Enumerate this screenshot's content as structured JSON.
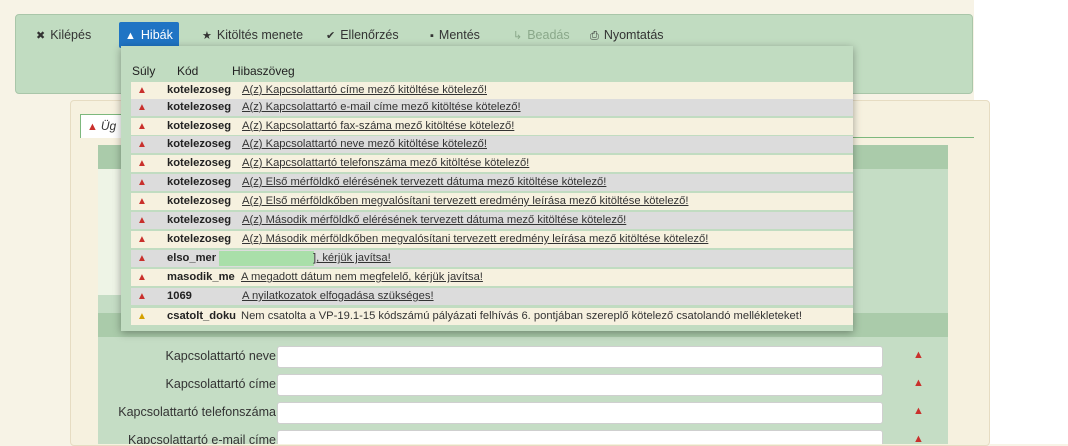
{
  "toolbar": {
    "buttons": [
      {
        "icon": "✖",
        "label": "Kilépés"
      },
      {
        "icon": "▲",
        "label": "Hibák"
      },
      {
        "icon": "★",
        "label": "Kitöltés menete"
      },
      {
        "icon": "✔",
        "label": "Ellenőrzés"
      },
      {
        "icon": "▪",
        "label": "Mentés"
      },
      {
        "icon": "↳",
        "label": "Beadás"
      },
      {
        "icon": "⎙",
        "label": "Nyomtatás"
      }
    ]
  },
  "errors_panel": {
    "headers": {
      "severity": "Súly",
      "code": "Kód",
      "message": "Hibaszöveg"
    },
    "rows": [
      {
        "severity": "error",
        "code": "kotelezoseg",
        "message": "A(z) Kapcsolattartó címe mező kitöltése kötelező!"
      },
      {
        "severity": "error",
        "code": "kotelezoseg",
        "message": "A(z) Kapcsolattartó e-mail címe mező kitöltése kötelező!"
      },
      {
        "severity": "error",
        "code": "kotelezoseg",
        "message": "A(z) Kapcsolattartó fax-száma mező kitöltése kötelező!"
      },
      {
        "severity": "error",
        "code": "kotelezoseg",
        "message": "A(z) Kapcsolattartó neve mező kitöltése kötelező!"
      },
      {
        "severity": "error",
        "code": "kotelezoseg",
        "message": "A(z) Kapcsolattartó telefonszáma mező kitöltése kötelező!"
      },
      {
        "severity": "error",
        "code": "kotelezoseg",
        "message": "A(z) Első mérföldkő elérésének tervezett dátuma mező kitöltése kötelező!"
      },
      {
        "severity": "error",
        "code": "kotelezoseg",
        "message": "A(z) Első mérföldkőben megvalósítani tervezett eredmény leírása mező kitöltése kötelező!"
      },
      {
        "severity": "error",
        "code": "kotelezoseg",
        "message": "A(z) Második mérföldkő elérésének tervezett dátuma mező kitöltése kötelező!"
      },
      {
        "severity": "error",
        "code": "kotelezoseg",
        "message": "A(z) Második mérföldkőben megvalósítani tervezett eredmény leírása mező kitöltése kötelező!"
      },
      {
        "severity": "error",
        "code": "elso_mer",
        "message": "",
        "message_tail": "], kérjük javítsa!"
      },
      {
        "severity": "error",
        "code": "masodik_me",
        "message": "A megadott dátum nem megfelelő, kérjük javítsa!"
      },
      {
        "severity": "error",
        "code": "1069",
        "message": "A nyilatkozatok elfogadása szükséges!"
      },
      {
        "severity": "warning",
        "code": "csatolt_doku",
        "message": "Nem csatolta a VP-19.1-15 kódszámú pályázati felhívás 6. pontjában szereplő kötelező csatolandó mellékleteket!"
      }
    ]
  },
  "tab": {
    "label": "Üg"
  },
  "form": {
    "fields": [
      {
        "label": "Kapcsolattartó neve",
        "value": ""
      },
      {
        "label": "Kapcsolattartó címe",
        "value": ""
      },
      {
        "label": "Kapcsolattartó telefonszáma",
        "value": ""
      },
      {
        "label": "Kapcsolattartó e-mail címe",
        "value": ""
      }
    ]
  },
  "colors": {
    "active_button": "#1f74c4",
    "toolbar_bg": "#c1dcc1",
    "error_icon": "#c9302c",
    "warning_icon": "#d4a000"
  }
}
